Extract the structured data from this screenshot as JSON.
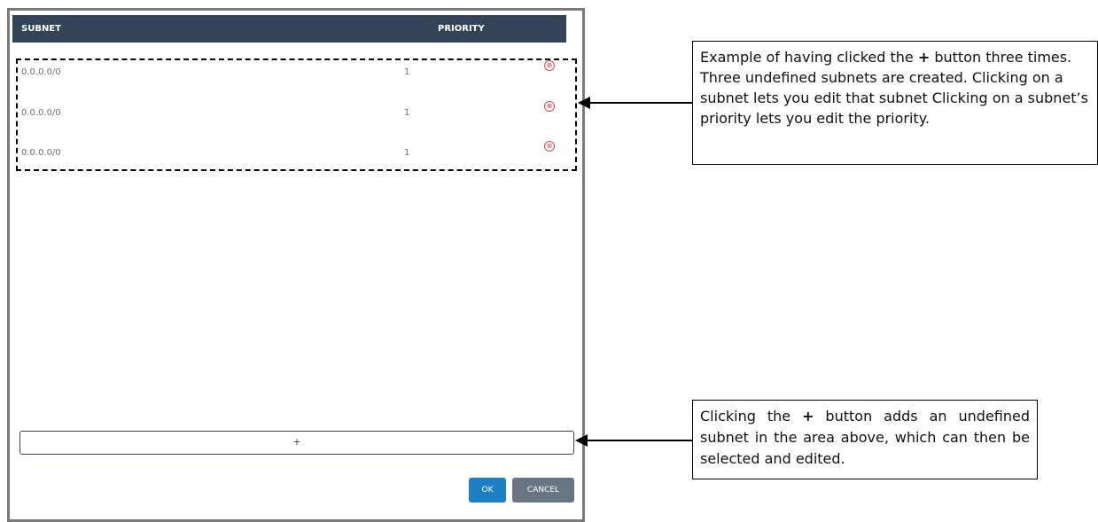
{
  "table": {
    "header_subnet": "SUBNET",
    "header_priority": "PRIORITY"
  },
  "rows": [
    {
      "subnet": "0.0.0.0/0",
      "priority": "1",
      "remove_icon": "⊗"
    },
    {
      "subnet": "0.0.0.0/0",
      "priority": "1",
      "remove_icon": "⊗"
    },
    {
      "subnet": "0.0.0.0/0",
      "priority": "1",
      "remove_icon": "⊗"
    }
  ],
  "buttons": {
    "add_label": "+",
    "ok_label": "OK",
    "cancel_label": "CANCEL"
  },
  "annotations": {
    "callout_1": {
      "part1": "Example of having clicked the ",
      "bold": "+",
      "part2": " button three times. Three undefined subnets are created. Clicking on a subnet lets you edit that subnet Clicking on a subnet’s priority lets you edit the priority."
    },
    "callout_2": {
      "part1": "Clicking the ",
      "bold": "+",
      "part2": " button adds an undefined subnet in the area above, which can then be selected and edited."
    }
  },
  "colors": {
    "header_bg": "#344458",
    "remove_icon": "#e0484b",
    "ok_button": "#1f7fc4",
    "cancel_button": "#6a7583"
  }
}
